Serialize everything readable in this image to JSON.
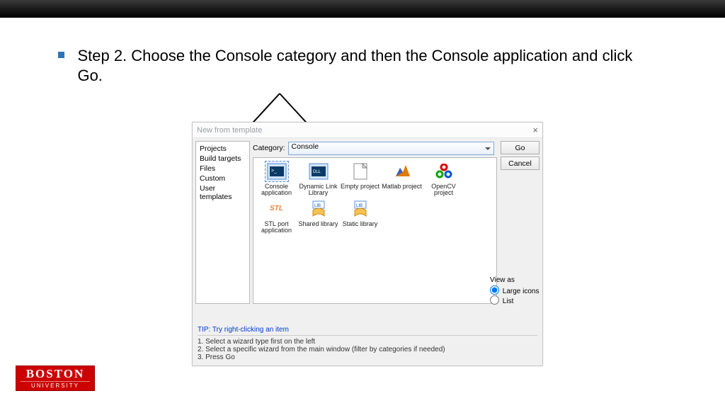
{
  "bullet_text": "Step 2. Choose the Console category and then the Console application and click Go.",
  "dialog": {
    "title": "New from template",
    "sidebar": {
      "items": [
        "Projects",
        "Build targets",
        "Files",
        "Custom",
        "User templates"
      ]
    },
    "category_label": "Category:",
    "category_value": "Console",
    "templates": [
      {
        "label": "Console application",
        "selected": true,
        "icon": "console"
      },
      {
        "label": "Dynamic Link Library",
        "selected": false,
        "icon": "dll"
      },
      {
        "label": "Empty project",
        "selected": false,
        "icon": "empty"
      },
      {
        "label": "Matlab project",
        "selected": false,
        "icon": "matlab"
      },
      {
        "label": "OpenCV project",
        "selected": false,
        "icon": "opencv"
      },
      {
        "label": "STL port application",
        "selected": false,
        "icon": "stl"
      },
      {
        "label": "Shared library",
        "selected": false,
        "icon": "lib"
      },
      {
        "label": "Static library",
        "selected": false,
        "icon": "lib"
      }
    ],
    "buttons": {
      "go": "Go",
      "cancel": "Cancel"
    },
    "view_as": {
      "heading": "View as",
      "opt_large": "Large icons",
      "opt_list": "List",
      "selected": "large"
    },
    "tip": "TIP: Try right-clicking an item",
    "steps": [
      "1. Select a wizard type first on the left",
      "2. Select a specific wizard from the main window (filter by categories if needed)",
      "3. Press Go"
    ]
  },
  "logo": {
    "line1": "BOSTON",
    "line2": "UNIVERSITY"
  }
}
